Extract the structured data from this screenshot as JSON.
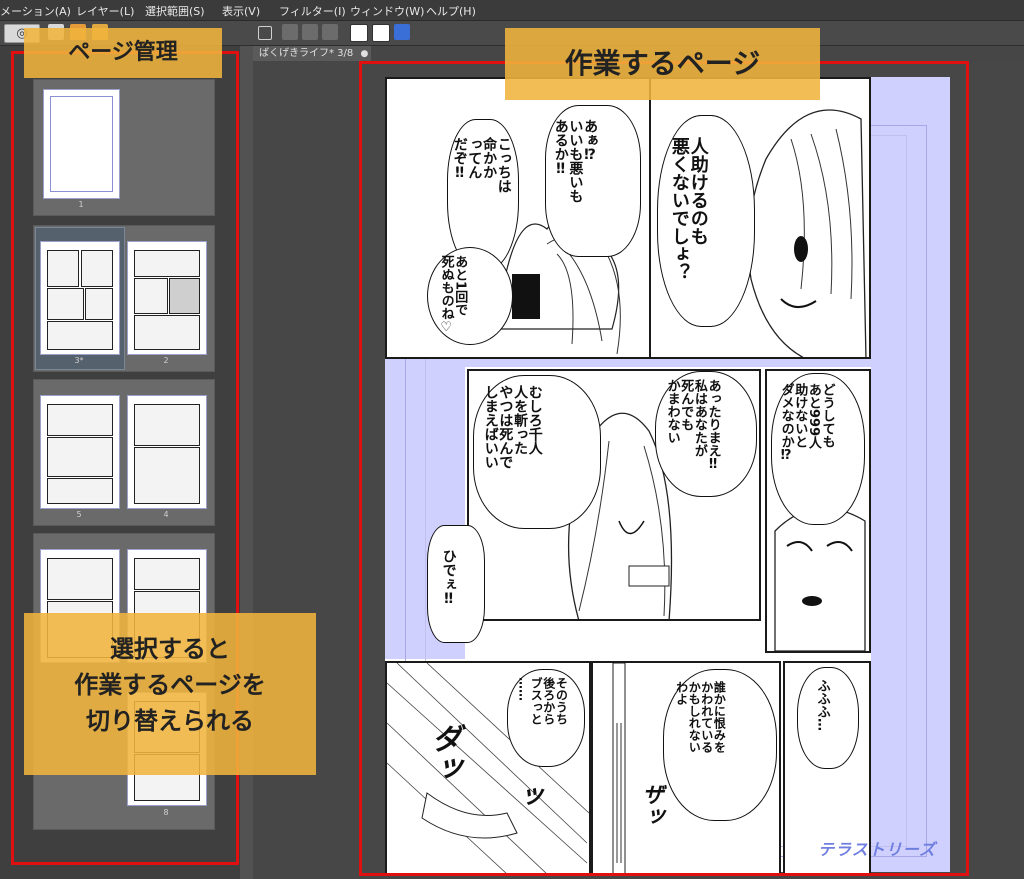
{
  "menubar": {
    "items": [
      "メーション(A)",
      "レイヤー(L)",
      "選択範囲(S)",
      "表示(V)",
      "フィルター(I)",
      "ウィンドウ(W)",
      "ヘルプ(H)"
    ]
  },
  "doc_tab": {
    "label": "ばくげきライフ* 3/8",
    "close": "●"
  },
  "pages_panel": {
    "page_numbers": [
      "1",
      "3*",
      "2",
      "5",
      "4",
      "8"
    ]
  },
  "annotations": {
    "page_management": "ページ管理",
    "working_page": "作業するページ",
    "switch_hint_line1": "選択すると",
    "switch_hint_line2": "作業するページを",
    "switch_hint_line3": "切り替えられる"
  },
  "manga": {
    "b1": "あぁ⁉\nいいも悪いも\nあるか‼",
    "b2": "こっちは\n命かか\nってん\nだぞ‼",
    "b3": "あと1回で\n死ぬものね♡",
    "b4": "人助けるのも\n悪くないでしょ？",
    "b5": "むしろ千人\n人を斬った\nやつは死んで\nしまえばいい",
    "b6": "あったりまえ‼\n私はあなたが\n死んでも\nかまわない",
    "b7": "どうしても\nあと999人\n助けないと\nダメなのか⁉",
    "b8": "ひでぇ‼",
    "b9": "そのうち\n後ろから\nブスっと\n……",
    "b10": "誰かに恨みを\nかわれている\nかもしれない\nわよ",
    "b11": "ふふふ…",
    "sfx1": "ダッ",
    "sfx2": "ザッ",
    "sfx3": "ッ"
  },
  "watermark": "テラストリーズ",
  "colors": {
    "red_frame": "#e01010",
    "label_bg": "#f0b43c",
    "bleed_area": "#d0d0ff"
  }
}
